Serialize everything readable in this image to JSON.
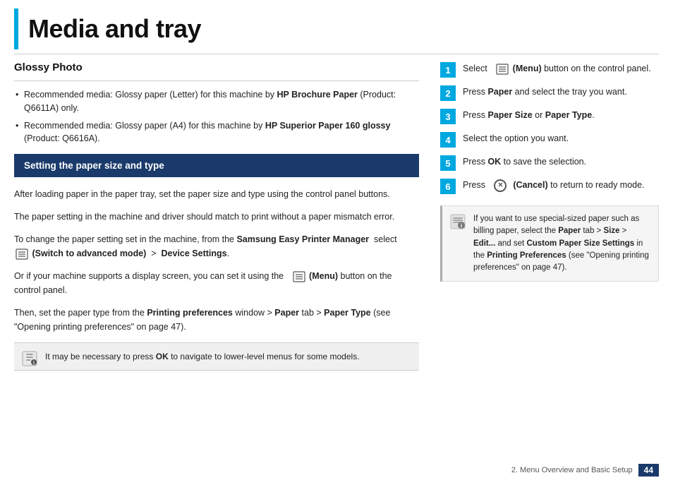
{
  "page": {
    "title": "Media and tray"
  },
  "left_column": {
    "glossy_photo": {
      "heading": "Glossy Photo",
      "bullets": [
        {
          "text_before": "Recommended media: Glossy paper (Letter) for this machine by ",
          "bold": "HP Brochure Paper",
          "text_after": " (Product: Q6611A) only."
        },
        {
          "text_before": "Recommended media: Glossy paper (A4) for this machine by ",
          "bold": "HP Superior Paper 160 glossy",
          "text_after": " (Product: Q6616A)."
        }
      ]
    },
    "setting_section": {
      "header": "Setting the paper size and type",
      "paragraphs": [
        "After loading paper in the paper tray, set the paper size and type using the control panel buttons.",
        "The paper setting in the machine and driver should match to print without a paper mismatch error.",
        {
          "type": "mixed",
          "parts": [
            {
              "text": "To change the paper setting set in the machine, from the "
            },
            {
              "bold": "Samsung Easy Printer Manager"
            },
            {
              "text": "  select  "
            },
            {
              "icon": "menu-icon"
            },
            {
              "bold": "(Switch to advanced mode)"
            },
            {
              "text": "  >  "
            },
            {
              "bold": "Device Settings"
            },
            {
              "text": "."
            }
          ]
        },
        {
          "type": "mixed",
          "parts": [
            {
              "text": "Or if your machine supports a display screen, you can set it using the "
            },
            {
              "icon": "menu-icon"
            },
            {
              "bold": "(Menu)"
            },
            {
              "text": " button on the control panel."
            }
          ]
        },
        {
          "type": "mixed",
          "parts": [
            {
              "text": "Then, set the paper type from the "
            },
            {
              "bold": "Printing preferences"
            },
            {
              "text": " window > "
            },
            {
              "bold": "Paper"
            },
            {
              "text": " tab > "
            },
            {
              "bold": "Paper Type"
            },
            {
              "text": " (see \"Opening printing preferences\" on page 47)."
            }
          ]
        }
      ],
      "note": {
        "text_before": "It may be necessary to press ",
        "bold": "OK",
        "text_after": " to navigate to lower-level menus for some models."
      }
    }
  },
  "right_column": {
    "steps": [
      {
        "number": "1",
        "text_before": "Select ",
        "icon": "menu-icon",
        "bold": "(Menu)",
        "text_after": " button on the control panel."
      },
      {
        "number": "2",
        "text_before": "Press ",
        "bold": "Paper",
        "text_after": " and select the tray you want."
      },
      {
        "number": "3",
        "text_before": "Press ",
        "bold1": "Paper Size",
        "middle": " or ",
        "bold2": "Paper Type",
        "text_after": "."
      },
      {
        "number": "4",
        "text": "Select the option you want."
      },
      {
        "number": "5",
        "text_before": "Press ",
        "bold": "OK",
        "text_after": " to save the selection."
      },
      {
        "number": "6",
        "text_before": "Press ",
        "icon": "cancel-icon",
        "bold": "(Cancel)",
        "text_after": " to return to ready mode."
      }
    ],
    "info_note": {
      "parts": [
        {
          "text": "If you want to use special-sized paper such as billing paper, select the "
        },
        {
          "bold": "Paper"
        },
        {
          "text": " tab > "
        },
        {
          "bold": "Size"
        },
        {
          "text": " > "
        },
        {
          "bold": "Edit..."
        },
        {
          "text": " and set "
        },
        {
          "bold": "Custom Paper Size Settings"
        },
        {
          "text": " in the "
        },
        {
          "bold": "Printing Preferences"
        },
        {
          "text": " (see \"Opening printing preferences\" on page 47)."
        }
      ]
    }
  },
  "footer": {
    "text": "2. Menu Overview and Basic Setup",
    "page_number": "44"
  }
}
